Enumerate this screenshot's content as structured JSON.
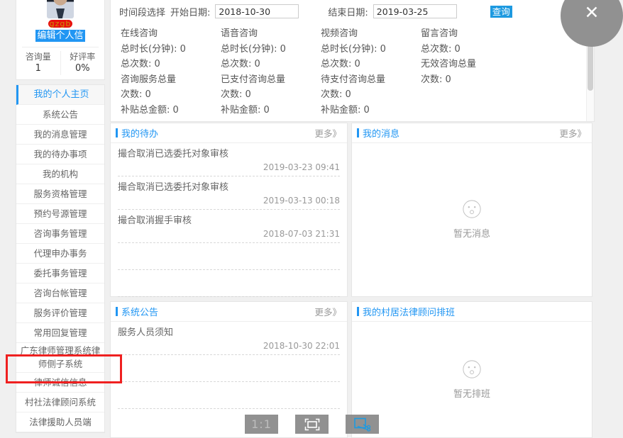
{
  "profile": {
    "name_redacted": "gzgb",
    "edit_button": "编辑个人信",
    "stats": [
      {
        "label": "咨询量",
        "value": "1"
      },
      {
        "label": "好评率",
        "value": "0%"
      }
    ]
  },
  "sidebar": {
    "items": [
      {
        "label": "我的个人主页",
        "active": true
      },
      {
        "label": "系统公告",
        "active": false
      },
      {
        "label": "我的消息管理",
        "active": false
      },
      {
        "label": "我的待办事项",
        "active": false
      },
      {
        "label": "我的机构",
        "active": false
      },
      {
        "label": "服务资格管理",
        "active": false
      },
      {
        "label": "预约号源管理",
        "active": false
      },
      {
        "label": "咨询事务管理",
        "active": false
      },
      {
        "label": "代理申办事务",
        "active": false
      },
      {
        "label": "委托事务管理",
        "active": false
      },
      {
        "label": "咨询台帐管理",
        "active": false
      },
      {
        "label": "服务评价管理",
        "active": false
      },
      {
        "label": "常用回复管理",
        "active": false
      },
      {
        "label": "广东律师管理系统律师侧子系统",
        "active": false,
        "two_line": true
      },
      {
        "label": "律师诚信信息",
        "active": false
      },
      {
        "label": "村社法律顾问系统",
        "active": false
      },
      {
        "label": "法律援助人员端",
        "active": false
      }
    ]
  },
  "filter": {
    "period_label": "时间段选择",
    "start_label": "开始日期:",
    "start_date": "2018-10-30",
    "end_label": "结束日期:",
    "end_date": "2019-03-25",
    "query_button": "查询"
  },
  "stats_columns": [
    {
      "title": "在线咨询",
      "lines": [
        "总时长(分钟): 0",
        "总次数: 0"
      ],
      "sub_title": "咨询服务总量",
      "sub_lines": [
        "次数: 0",
        "补贴总金额: 0"
      ]
    },
    {
      "title": "语音咨询",
      "lines": [
        "总时长(分钟): 0",
        "总次数: 0"
      ],
      "sub_title": "已支付咨询总量",
      "sub_lines": [
        "次数: 0",
        "补贴金额: 0"
      ]
    },
    {
      "title": "视频咨询",
      "lines": [
        "总时长(分钟): 0",
        "总次数: 0"
      ],
      "sub_title": "待支付咨询总量",
      "sub_lines": [
        "次数: 0",
        "补贴金额: 0"
      ]
    },
    {
      "title": "留言咨询",
      "lines": [
        "总次数: 0",
        ""
      ],
      "sub_title": "无效咨询总量",
      "sub_lines": [
        "次数: 0",
        ""
      ]
    }
  ],
  "panels": {
    "todo": {
      "title": "我的待办",
      "more": "更多》",
      "items": [
        {
          "title": "撮合取消已选委托对象审核",
          "time": "2019-03-23 09:41"
        },
        {
          "title": "撮合取消已选委托对象审核",
          "time": "2019-03-13 00:18"
        },
        {
          "title": "撮合取消握手审核",
          "time": "2018-07-03 21:31"
        }
      ],
      "empty_rows": 2
    },
    "messages": {
      "title": "我的消息",
      "more": "更多》",
      "empty_text": "暂无消息"
    },
    "announcements": {
      "title": "系统公告",
      "more": "更多》",
      "items": [
        {
          "title": "服务人员须知",
          "time": "2018-10-30 22:01"
        }
      ],
      "empty_rows": 2
    },
    "schedule": {
      "title": "我的村居法律顾问排班",
      "empty_text": "暂无排班"
    }
  },
  "toolbar": {
    "scale_label": "1:1",
    "fullscreen_label": "fullscreen-icon",
    "snip_label": "snip-icon"
  },
  "close_button": {
    "glyph": "✕"
  },
  "colors": {
    "accent": "#2196f3",
    "button_blue": "#1e9ae0",
    "annotation_red": "#ef2020",
    "panel_bg": "#ffffff",
    "page_bg": "#f0f0f0"
  }
}
